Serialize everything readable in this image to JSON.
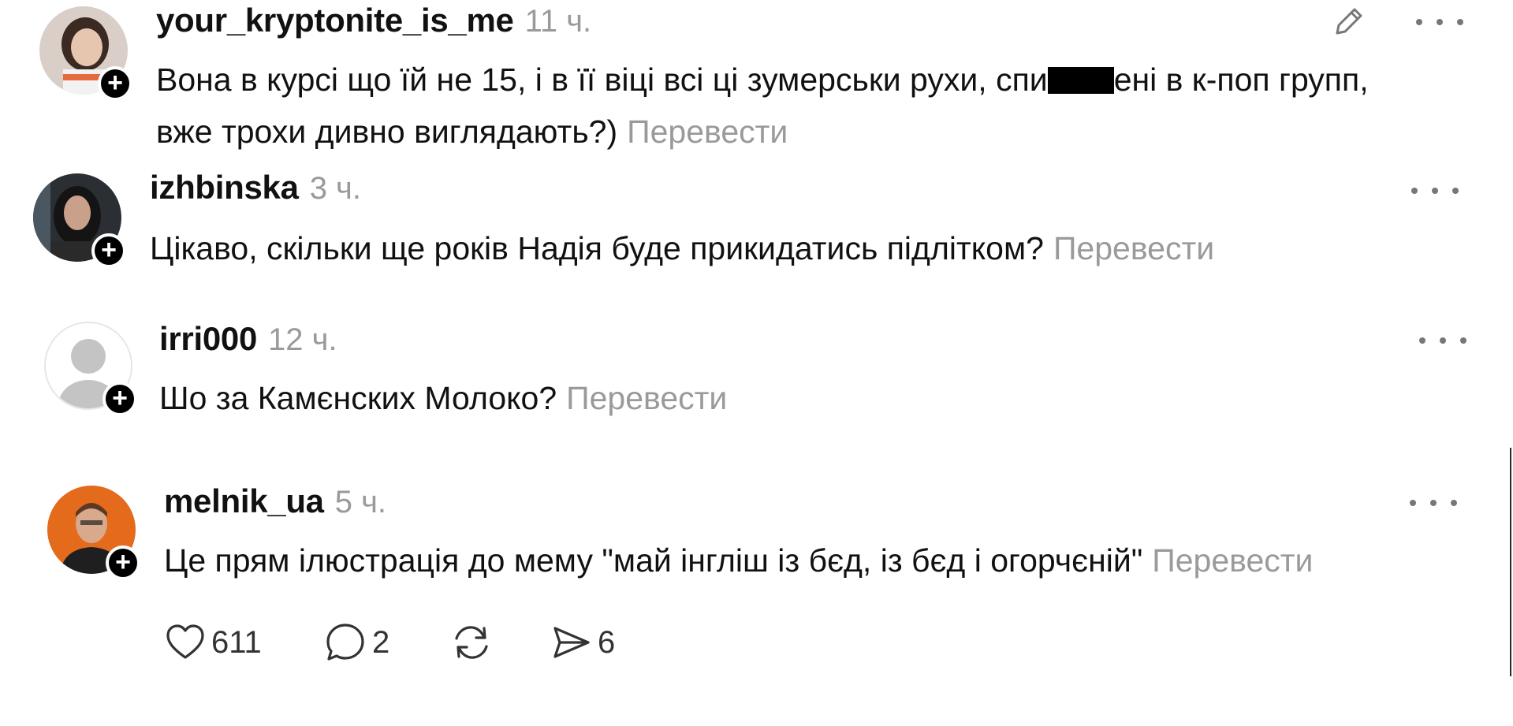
{
  "comments": [
    {
      "username": "your_kryptonite_is_me",
      "time": "11 ч.",
      "text_before_redaction": "Вона в курсі що їй не 15, і в її віці всі ці зумерськи рухи, спи",
      "text_after_redaction": "ені в к-поп групп, вже трохи дивно виглядають?)",
      "translate": "Перевести"
    },
    {
      "username": "izhbinska",
      "time": "3 ч.",
      "text": "Цікаво, скільки ще років Надія буде прикидатись підлітком?",
      "translate": "Перевести"
    },
    {
      "username": "irri000",
      "time": "12 ч.",
      "text": "Шо за Камєнских Молоко?",
      "translate": "Перевести"
    },
    {
      "username": "melnik_ua",
      "time": "5 ч.",
      "text": "Це прям ілюстрація до мему \"май інгліш із бєд, із бєд і огорчєній\"",
      "translate": "Перевести"
    }
  ],
  "actions": {
    "likes": "611",
    "replies": "2",
    "shares": "6"
  },
  "icons": {
    "more": "more-horizontal-icon",
    "edit": "pencil-icon",
    "follow": "plus-icon",
    "like": "heart-icon",
    "reply": "speech-bubble-icon",
    "repost": "repost-icon",
    "share": "send-icon"
  }
}
